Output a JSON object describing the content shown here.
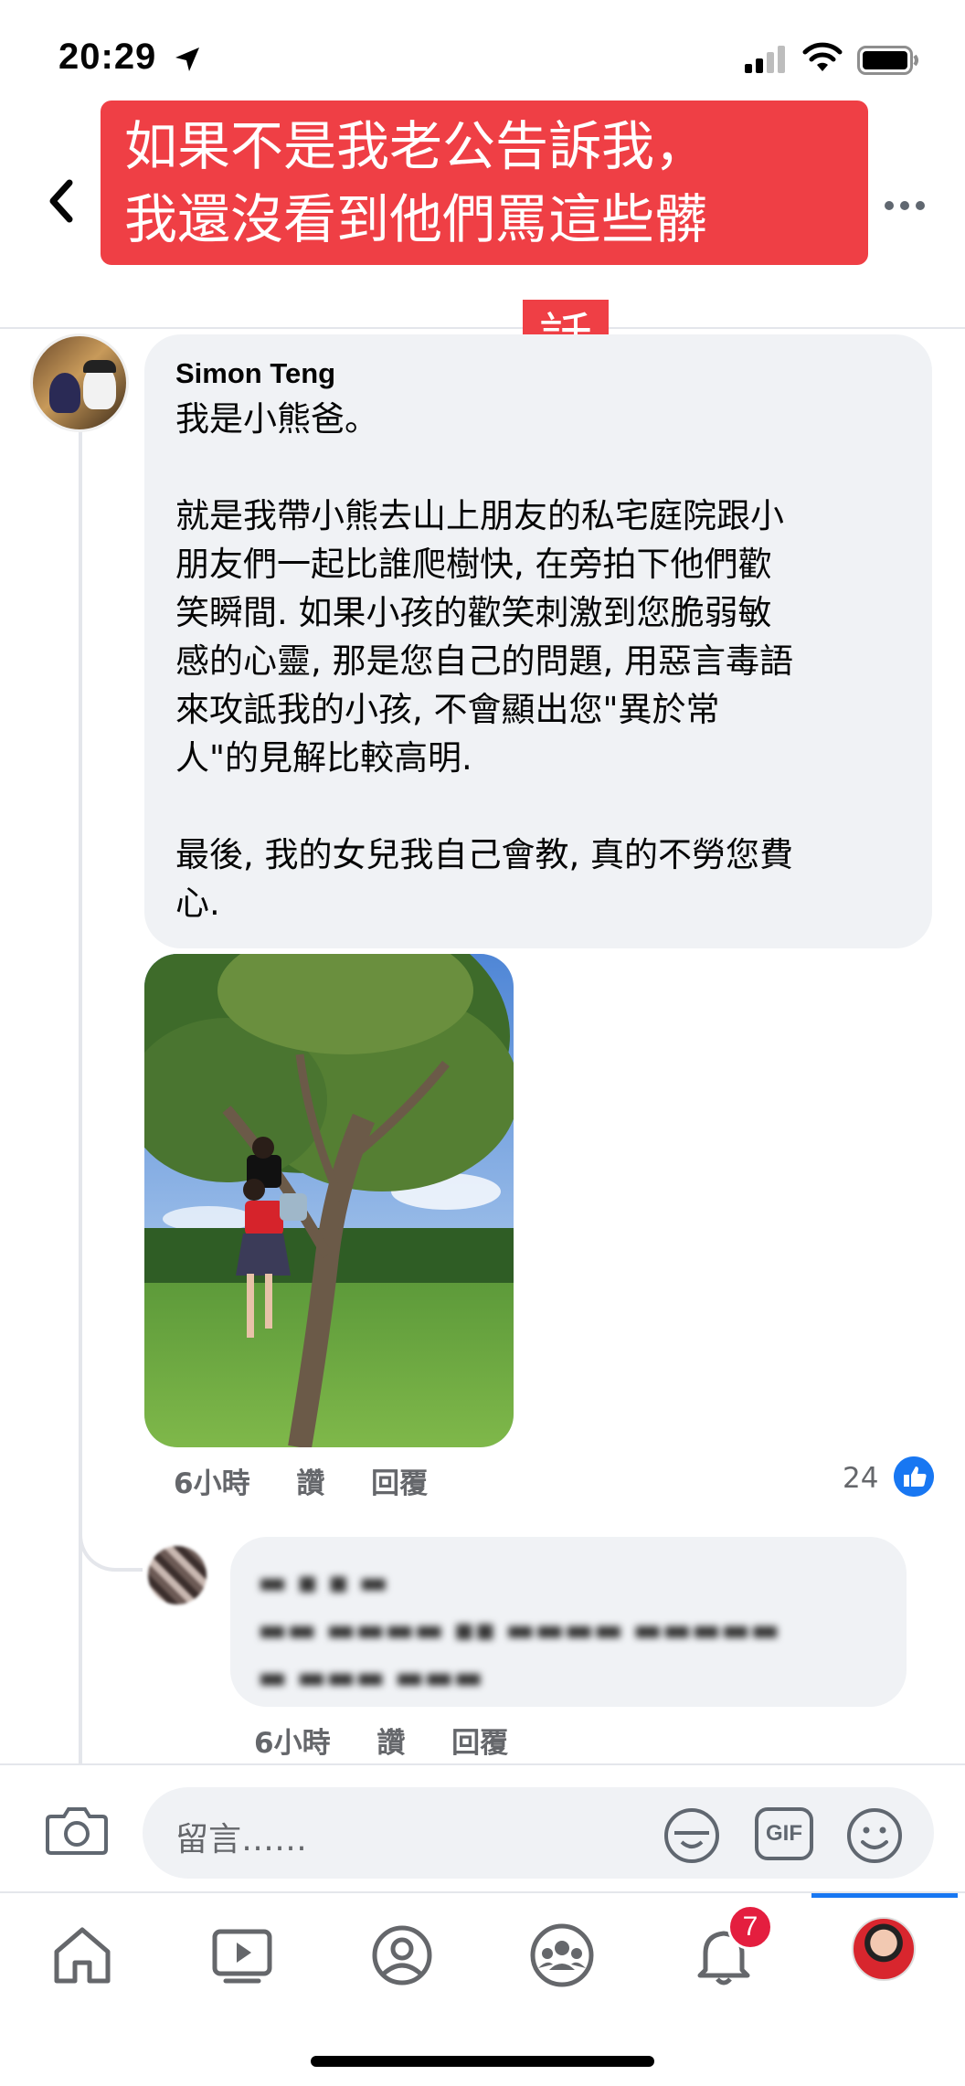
{
  "status_bar": {
    "time": "20:29"
  },
  "banner": {
    "line1": "如果不是我老公告訴我，",
    "line2": "我還沒看到他們罵這些髒",
    "line3": "話",
    "color": "#ef3f45"
  },
  "comment": {
    "author": "Simon Teng",
    "body": "我是小熊爸。\n\n就是我帶小熊去山上朋友的私宅庭院跟小\n朋友們一起比誰爬樹快, 在旁拍下他們歡\n笑瞬間. 如果小孩的歡笑刺激到您脆弱敏\n感的心靈, 那是您自己的問題, 用惡言毒語\n來攻詆我的小孩, 不會顯出您\"異於常\n人\"的見解比較高明.\n\n最後, 我的女兒我自己會教, 真的不勞您費\n心.",
    "time": "6小時",
    "like_label": "讚",
    "reply_label": "回覆",
    "like_count": "24"
  },
  "reply": {
    "time": "6小時",
    "like_label": "讚",
    "reply_label": "回覆"
  },
  "composer": {
    "placeholder": "留言……",
    "gif_label": "GIF"
  },
  "tabbar": {
    "notification_count": "7",
    "accent": "#1877f2"
  }
}
